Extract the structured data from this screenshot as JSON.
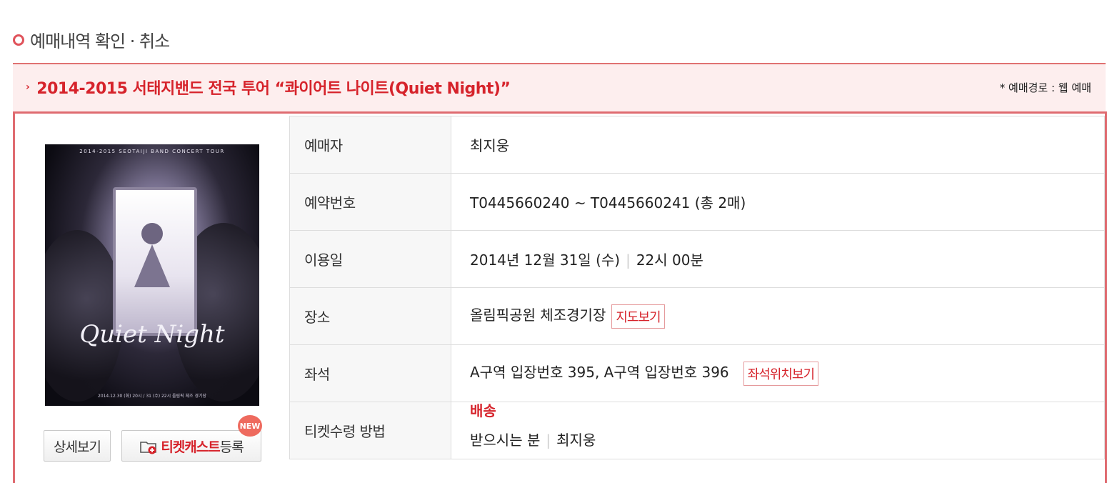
{
  "page": {
    "title": "예매내역 확인 · 취소"
  },
  "event": {
    "title": "2014-2015 서태지밴드 전국 투어 “콰이어트 나이트(Quiet Night)”",
    "purchase_route": "* 예매경로 : 웹 예매"
  },
  "poster": {
    "header": "2014·2015 SEOTAIJI BAND CONCERT TOUR",
    "logo": "Quiet Night",
    "footer": "2014.12.30 (화) 20시 / 31 (수) 22시 올림픽 체조 경기장"
  },
  "buttons": {
    "detail": "상세보기",
    "ticketcast_red": "티켓캐스트",
    "ticketcast_dark": "등록",
    "new_badge": "NEW"
  },
  "info": {
    "booker": {
      "label": "예매자",
      "value": "최지웅"
    },
    "reservation": {
      "label": "예약번호",
      "value": "T0445660240 ~ T0445660241 (총 2매)"
    },
    "date": {
      "label": "이용일",
      "date": "2014년 12월 31일 (수)",
      "sep": "|",
      "time": "22시 00분"
    },
    "venue": {
      "label": "장소",
      "value": "올림픽공원 체조경기장",
      "map_button": "지도보기"
    },
    "seat": {
      "label": "좌석",
      "value": "A구역 입장번호 395, A구역 입장번호 396",
      "seat_button": "좌석위치보기"
    },
    "ticket_method": {
      "label": "티켓수령 방법",
      "method": "배송",
      "recipient_label": "받으시는 분",
      "sep": "|",
      "recipient": "최지웅"
    }
  },
  "colors": {
    "accent": "#d6232b",
    "bar_bg": "#fdeeee",
    "border": "#df6b70"
  }
}
